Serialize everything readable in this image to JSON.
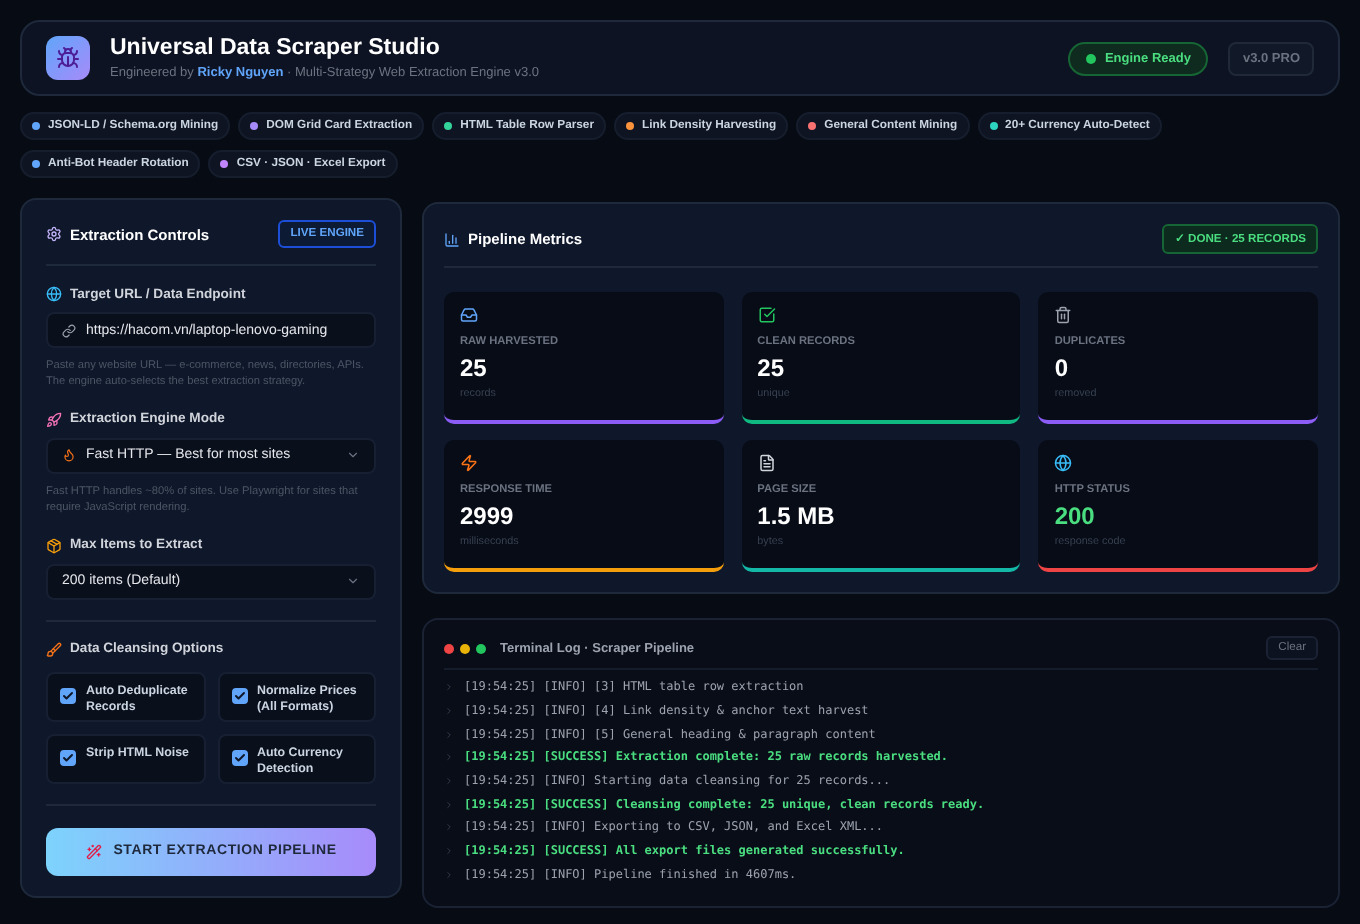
{
  "header": {
    "title": "Universal Data Scraper Studio",
    "subtitle_prefix": "Engineered by",
    "author": "Ricky Nguyen",
    "subtitle_suffix": "· Multi-Strategy Web Extraction Engine v3.0",
    "status": "Engine Ready",
    "version": "v3.0 PRO"
  },
  "features": [
    {
      "label": "JSON-LD / Schema.org Mining",
      "color": "#60a5fa"
    },
    {
      "label": "DOM Grid Card Extraction",
      "color": "#a78bfa"
    },
    {
      "label": "HTML Table Row Parser",
      "color": "#34d399"
    },
    {
      "label": "Link Density Harvesting",
      "color": "#fb923c"
    },
    {
      "label": "General Content Mining",
      "color": "#f87171"
    },
    {
      "label": "20+ Currency Auto-Detect",
      "color": "#2dd4bf"
    },
    {
      "label": "Anti-Bot Header Rotation",
      "color": "#60a5fa"
    },
    {
      "label": "CSV · JSON · Excel Export",
      "color": "#c084fc"
    }
  ],
  "controls": {
    "title": "Extraction Controls",
    "badge": "LIVE ENGINE",
    "url": {
      "label": "Target URL / Data Endpoint",
      "value": "https://hacom.vn/laptop-lenovo-gaming",
      "hint": "Paste any website URL — e-commerce, news, directories, APIs. The engine auto-selects the best extraction strategy."
    },
    "mode": {
      "label": "Extraction Engine Mode",
      "value": "Fast HTTP — Best for most sites",
      "hint": "Fast HTTP handles ~80% of sites. Use Playwright for sites that require JavaScript rendering."
    },
    "max_items": {
      "label": "Max Items to Extract",
      "value": "200 items (Default)"
    },
    "cleansing_title": "Data Cleansing Options",
    "options": [
      {
        "label": "Auto Deduplicate Records",
        "checked": true
      },
      {
        "label": "Normalize Prices (All Formats)",
        "checked": true
      },
      {
        "label": "Strip HTML Noise",
        "checked": true
      },
      {
        "label": "Auto Currency Detection",
        "checked": true
      }
    ],
    "start_button": "START EXTRACTION PIPELINE"
  },
  "metrics": {
    "title": "Pipeline Metrics",
    "badge": "✓ DONE · 25 RECORDS",
    "cards": [
      {
        "kind": "inbox",
        "label": "RAW HARVESTED",
        "value": "25",
        "unit": "records",
        "color": "#8b5cf6"
      },
      {
        "kind": "check",
        "label": "CLEAN RECORDS",
        "value": "25",
        "unit": "unique",
        "color": "#10b981"
      },
      {
        "kind": "trash",
        "label": "DUPLICATES",
        "value": "0",
        "unit": "removed",
        "color": "#8b5cf6"
      },
      {
        "kind": "bolt",
        "label": "RESPONSE TIME",
        "value": "2999",
        "unit": "milliseconds",
        "color": "#f59e0b"
      },
      {
        "kind": "file",
        "label": "PAGE SIZE",
        "value": "1.5 MB",
        "unit": "bytes",
        "color": "#14b8a6"
      },
      {
        "kind": "globe",
        "label": "HTTP STATUS",
        "value": "200",
        "unit": "response code",
        "color": "#ef4444"
      }
    ]
  },
  "terminal": {
    "title": "Terminal Log · Scraper Pipeline",
    "clear": "Clear",
    "lines": [
      {
        "kind": "info",
        "text": "[19:54:25] [INFO] [3] HTML table row extraction"
      },
      {
        "kind": "info",
        "text": "[19:54:25] [INFO] [4] Link density & anchor text harvest"
      },
      {
        "kind": "info",
        "text": "[19:54:25] [INFO] [5] General heading & paragraph content"
      },
      {
        "kind": "success",
        "text": "[19:54:25] [SUCCESS] Extraction complete: 25 raw records harvested."
      },
      {
        "kind": "info",
        "text": "[19:54:25] [INFO] Starting data cleansing for 25 records..."
      },
      {
        "kind": "success",
        "text": "[19:54:25] [SUCCESS] Cleansing complete: 25 unique, clean records ready."
      },
      {
        "kind": "info",
        "text": "[19:54:25] [INFO] Exporting to CSV, JSON, and Excel XML..."
      },
      {
        "kind": "success",
        "text": "[19:54:25] [SUCCESS] All export files generated successfully."
      },
      {
        "kind": "info",
        "text": "[19:54:25] [INFO] Pipeline finished in 4607ms."
      }
    ]
  }
}
